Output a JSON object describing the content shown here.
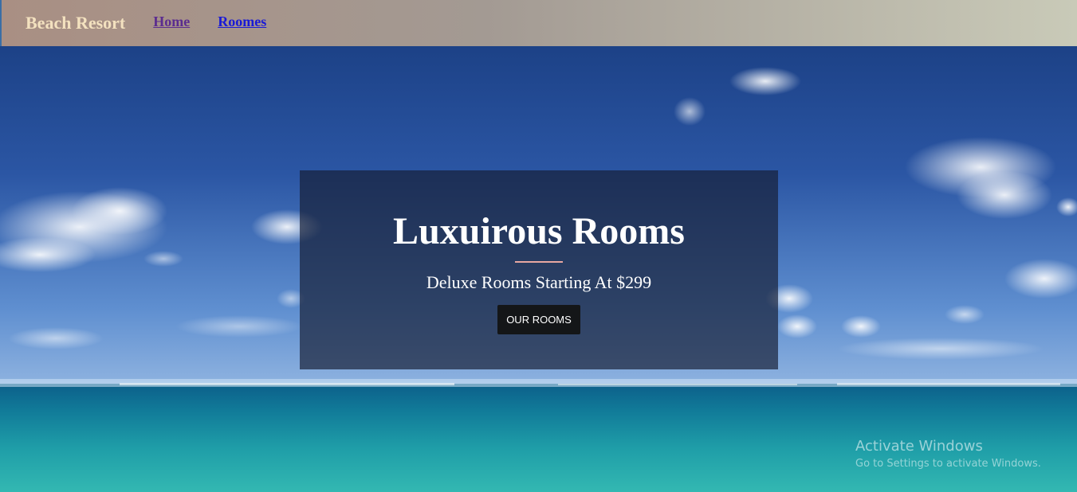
{
  "navbar": {
    "brand": "Beach Resort",
    "links": [
      {
        "label": "Home"
      },
      {
        "label": "Roomes"
      }
    ]
  },
  "hero": {
    "title": "Luxuirous Rooms",
    "subtitle": "Deluxe Rooms Starting At $299",
    "button_label": "OUR ROOMS"
  },
  "watermark": {
    "title": "Activate Windows",
    "subtitle": "Go to Settings to activate Windows."
  },
  "colors": {
    "brand_text": "#f3e1bf",
    "banner_bg": "rgba(22,30,52,0.68)",
    "divider": "#e8a7a1",
    "button_bg": "#141618",
    "visited_link": "#5b2c8f",
    "link": "#1a1ad6"
  }
}
